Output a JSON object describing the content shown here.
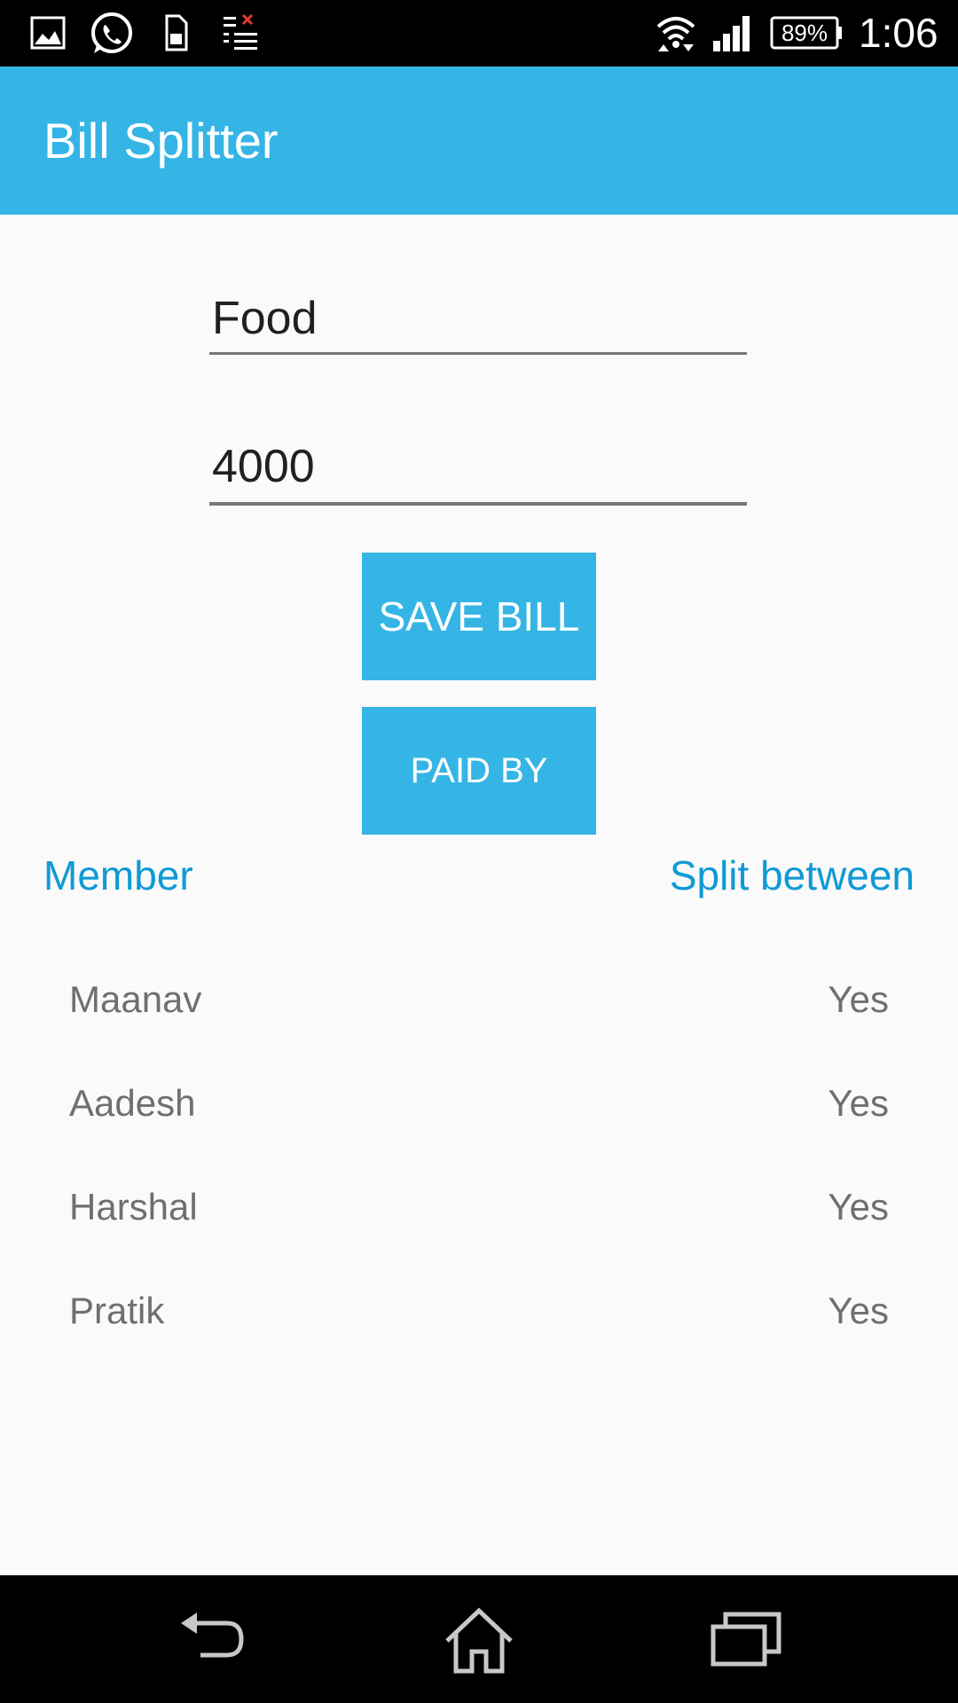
{
  "status_bar": {
    "icons": [
      "gallery-icon",
      "whatsapp-icon",
      "sd-card-icon",
      "task-list-icon",
      "wifi-icon",
      "signal-icon",
      "battery-icon"
    ],
    "battery_percent": "89%",
    "time": "1:06"
  },
  "app_bar": {
    "title": "Bill Splitter",
    "color": "#35b5e5"
  },
  "form": {
    "bill_name_value": "Food",
    "amount_value": "4000"
  },
  "buttons": {
    "save_label": "SAVE BILL",
    "paid_by_label": "PAID BY"
  },
  "list": {
    "header_member": "Member",
    "header_split": "Split between",
    "rows": [
      {
        "name": "Maanav",
        "split": "Yes"
      },
      {
        "name": "Aadesh",
        "split": "Yes"
      },
      {
        "name": "Harshal",
        "split": "Yes"
      },
      {
        "name": "Pratik",
        "split": "Yes"
      }
    ]
  },
  "nav_bar": {
    "icons": [
      "back-icon",
      "home-icon",
      "recents-icon"
    ]
  },
  "colors": {
    "accent": "#35b5e5",
    "header_text": "#0f9ad6",
    "row_text": "#6f6f6f",
    "background": "#fafafa"
  }
}
